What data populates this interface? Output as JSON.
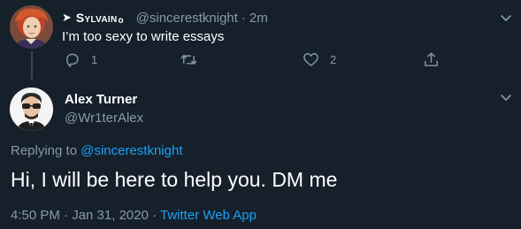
{
  "parent_tweet": {
    "display_name": "Sylvain",
    "name_prefix": "➤",
    "name_suffix": "o",
    "handle": "@sincerestknight",
    "separator": "·",
    "time": "2m",
    "text": "I’m too sexy to write essays",
    "reply_count": "1",
    "like_count": "2"
  },
  "reply_tweet": {
    "display_name": "Alex Turner",
    "handle": "@Wr1terAlex",
    "replying_to_label": "Replying to",
    "replying_to_handle": "@sincerestknight",
    "text": "Hi, I will be here to help you. DM me",
    "timestamp": "4:50 PM · Jan 31, 2020",
    "separator": "·",
    "source_app": "Twitter Web App"
  },
  "colors": {
    "background": "#15202b",
    "primary_text": "#ffffff",
    "secondary_text": "#8899a6",
    "link": "#1da1f2",
    "thread_line": "#38444d"
  }
}
